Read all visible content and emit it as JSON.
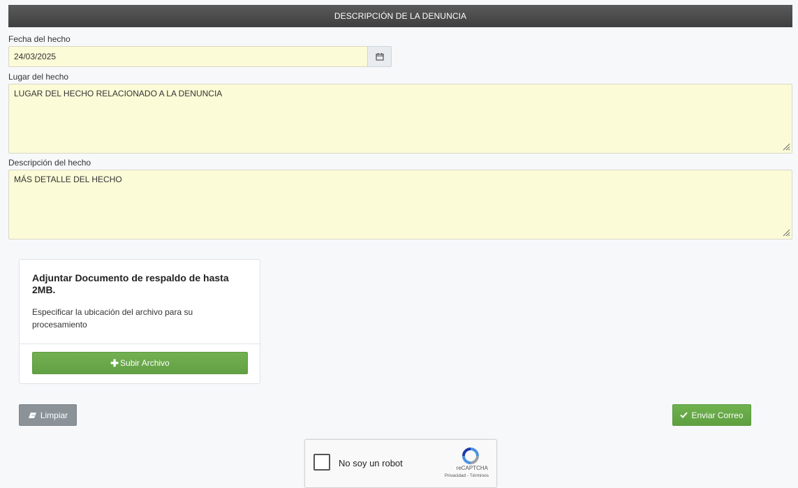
{
  "section": {
    "title": "DESCRIPCIÓN DE LA DENUNCIA"
  },
  "fields": {
    "fecha": {
      "label": "Fecha del hecho",
      "value": "24/03/2025",
      "icon": "calendar-icon"
    },
    "lugar": {
      "label": "Lugar del hecho",
      "value": "LUGAR DEL HECHO RELACIONADO A LA DENUNCIA"
    },
    "descripcion": {
      "label": "Descripción del hecho",
      "value": "MÁS DETALLE DEL HECHO"
    }
  },
  "upload": {
    "title": "Adjuntar Documento de respaldo de hasta 2MB.",
    "description": "Especificar la ubicación del archivo para su procesamiento",
    "button_label": "Subir Archivo",
    "button_icon": "plus-icon"
  },
  "actions": {
    "clear_label": "Limpiar",
    "clear_icon": "eraser-icon",
    "send_label": "Enviar Correo",
    "send_icon": "check-icon"
  },
  "captcha": {
    "label": "No soy un robot",
    "brand": "reCAPTCHA",
    "links": "Privacidad - Términos"
  },
  "colors": {
    "input_bg": "#fcfbd7",
    "header_bg": "#4a4a4a",
    "success": "#62a044",
    "secondary": "#8b9399"
  }
}
